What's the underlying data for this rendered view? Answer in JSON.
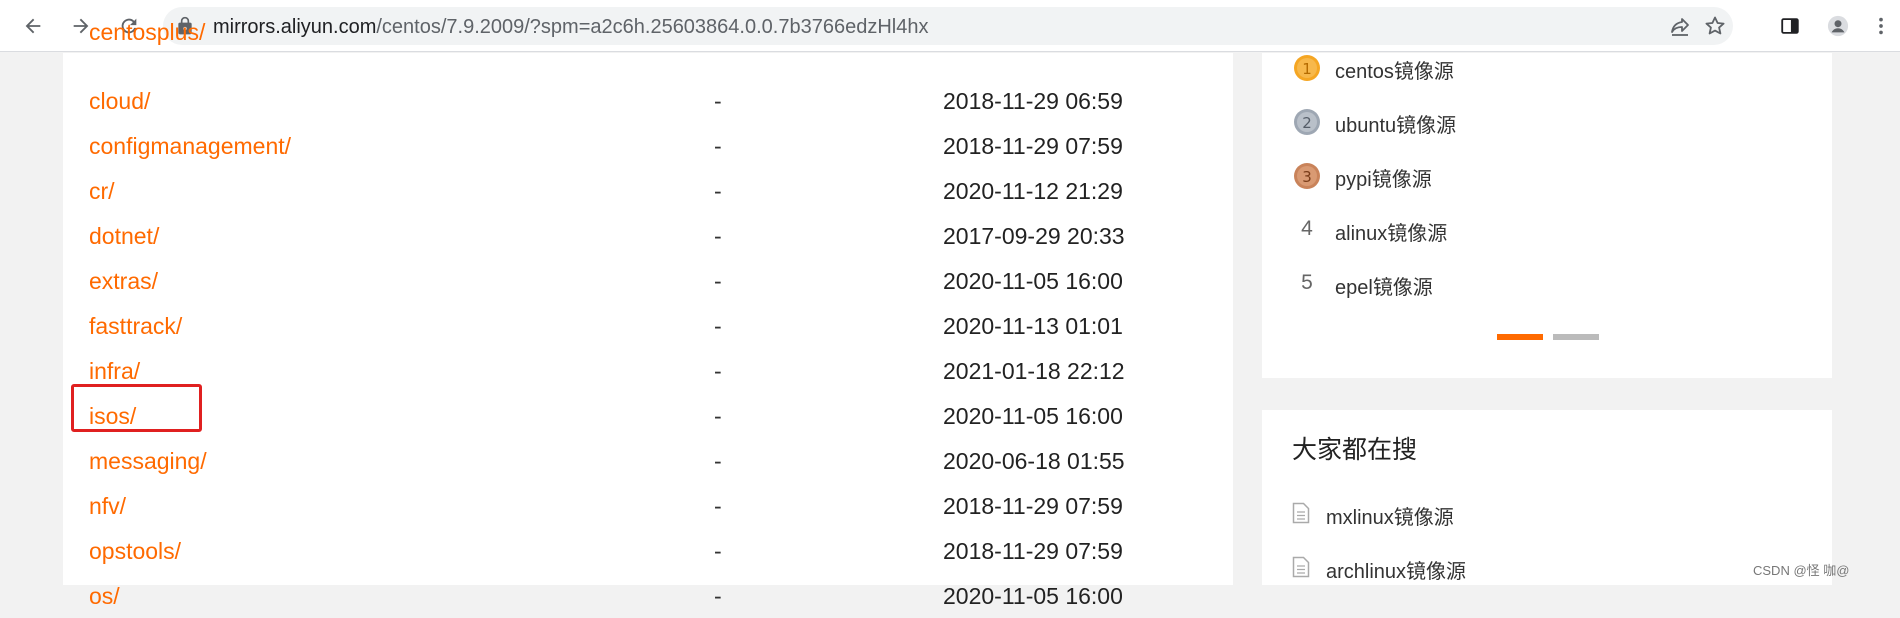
{
  "browser": {
    "url_host": "mirrors.aliyun.com",
    "url_path": "/centos/7.9.2009/?spm=a2c6h.25603864.0.0.7b3766edzHl4hx"
  },
  "files": [
    {
      "name": "cloud/",
      "size": "-",
      "date": "2018-11-29 06:59"
    },
    {
      "name": "configmanagement/",
      "size": "-",
      "date": "2018-11-29 07:59"
    },
    {
      "name": "cr/",
      "size": "-",
      "date": "2020-11-12 21:29"
    },
    {
      "name": "dotnet/",
      "size": "-",
      "date": "2017-09-29 20:33"
    },
    {
      "name": "extras/",
      "size": "-",
      "date": "2020-11-05 16:00"
    },
    {
      "name": "fasttrack/",
      "size": "-",
      "date": "2020-11-13 01:01"
    },
    {
      "name": "infra/",
      "size": "-",
      "date": "2021-01-18 22:12"
    },
    {
      "name": "isos/",
      "size": "-",
      "date": "2020-11-05 16:00"
    },
    {
      "name": "messaging/",
      "size": "-",
      "date": "2020-06-18 01:55"
    },
    {
      "name": "nfv/",
      "size": "-",
      "date": "2018-11-29 07:59"
    },
    {
      "name": "opstools/",
      "size": "-",
      "date": "2018-11-29 07:59"
    },
    {
      "name": "os/",
      "size": "-",
      "date": "2020-11-05 16:00"
    }
  ],
  "ranking": {
    "items": [
      {
        "rank": "1",
        "label": "centos镜像源"
      },
      {
        "rank": "2",
        "label": "ubuntu镜像源"
      },
      {
        "rank": "3",
        "label": "pypi镜像源"
      },
      {
        "rank": "4",
        "label": "alinux镜像源"
      },
      {
        "rank": "5",
        "label": "epel镜像源"
      }
    ]
  },
  "popular_search": {
    "title": "大家都在搜",
    "items": [
      {
        "label": "mxlinux镜像源"
      },
      {
        "label": "archlinux镜像源"
      }
    ]
  },
  "watermark": "CSDN @怪 咖@",
  "colors": {
    "link": "#ff6a00",
    "highlight": "#e02020",
    "carousel_active": "#ff6a00",
    "carousel_inactive": "#bbbbbb"
  }
}
